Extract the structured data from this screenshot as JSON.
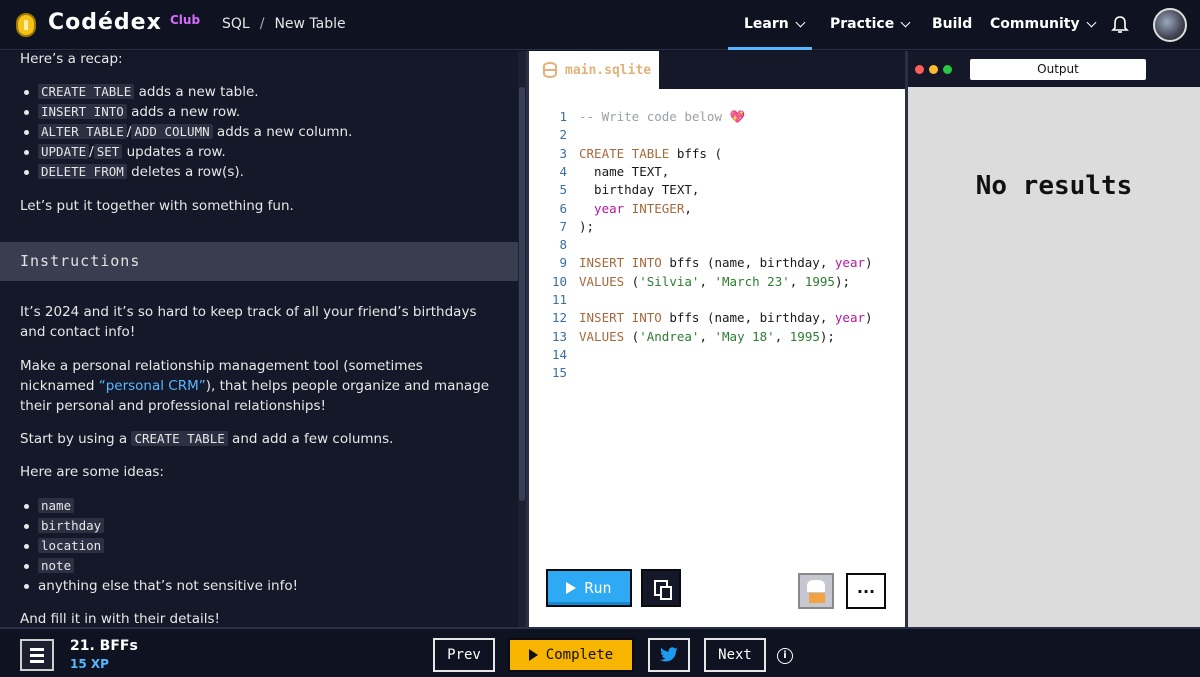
{
  "header": {
    "logo_text": "Codédex",
    "logo_badge": "Club",
    "breadcrumb": [
      "SQL",
      "/",
      "New Table"
    ],
    "nav": [
      {
        "label": "Learn",
        "dropdown": true,
        "active": true
      },
      {
        "label": "Practice",
        "dropdown": true
      },
      {
        "label": "Build",
        "dropdown": false
      },
      {
        "label": "Community",
        "dropdown": true
      }
    ],
    "icons": {
      "bell": "bell-icon",
      "avatar": "user-avatar"
    }
  },
  "lesson": {
    "recap_intro": "Here’s a recap:",
    "recap_items": [
      {
        "code": "CREATE TABLE",
        "text": " adds a new table."
      },
      {
        "code": "INSERT INTO",
        "text": " adds a new row."
      },
      {
        "code": "ALTER TABLE",
        "sep": "/",
        "code2": "ADD COLUMN",
        "text": " adds a new column."
      },
      {
        "code": "UPDATE",
        "sep": "/",
        "code2": "SET",
        "text": " updates a row."
      },
      {
        "code": "DELETE FROM",
        "text": " deletes a row(s)."
      }
    ],
    "recap_outro": "Let’s put it together with something fun.",
    "instructions_heading": "Instructions",
    "p1": "It’s 2024 and it’s so hard to keep track of all your friend’s birthdays and contact info!",
    "p2_before": "Make a personal relationship management tool (sometimes nicknamed ",
    "p2_link": "“personal CRM”",
    "p2_after": "), that helps people organize and manage their personal and professional relationships!",
    "p3_before": "Start by using a ",
    "p3_code": "CREATE TABLE",
    "p3_after": " and add a few columns.",
    "ideas_intro": "Here are some ideas:",
    "ideas": [
      "name",
      "birthday",
      "location",
      "note"
    ],
    "ideas_last": "anything else that’s not sensitive info!",
    "final": "And fill it in with their details!"
  },
  "editor": {
    "tab": "main.sqlite",
    "lines": [
      {
        "n": "1"
      },
      {
        "n": "2"
      },
      {
        "n": "3"
      },
      {
        "n": "4"
      },
      {
        "n": "5"
      },
      {
        "n": "6"
      },
      {
        "n": "7"
      },
      {
        "n": "8"
      },
      {
        "n": "9"
      },
      {
        "n": "10"
      },
      {
        "n": "11"
      },
      {
        "n": "12"
      },
      {
        "n": "13"
      },
      {
        "n": "14"
      },
      {
        "n": "15"
      }
    ],
    "code": {
      "l1": "-- Write code below 💖",
      "l3a": "CREATE TABLE",
      "l3b": " bffs (",
      "l4": "  name TEXT,",
      "l5": "  birthday TEXT,",
      "l6a": "  year",
      "l6b": " INTEGER",
      "l6c": ",",
      "l7": ");",
      "l9a": "INSERT INTO",
      "l9b": " bffs (name, birthday, ",
      "l9c": "year",
      "l9d": ")",
      "l10a": "VALUES",
      "l10b": " (",
      "l10c": "'Silvia'",
      "l10d": ", ",
      "l10e": "'March 23'",
      "l10f": ", ",
      "l10g": "1995",
      "l10h": ");",
      "l12a": "INSERT INTO",
      "l12b": " bffs (name, birthday, ",
      "l12c": "year",
      "l12d": ")",
      "l13a": "VALUES",
      "l13b": " (",
      "l13c": "'Andrea'",
      "l13d": ", ",
      "l13e": "'May 18'",
      "l13f": ", ",
      "l13g": "1995",
      "l13h": ");"
    },
    "run_label": "Run",
    "more_label": "···"
  },
  "output": {
    "title": "Output",
    "empty": "No results",
    "dots": [
      "#ff5f57",
      "#febc2e",
      "#28c840"
    ]
  },
  "footer": {
    "exercise": "21. BFFs",
    "xp": "15 XP",
    "prev": "Prev",
    "complete": "Complete",
    "next": "Next",
    "info": "i"
  }
}
